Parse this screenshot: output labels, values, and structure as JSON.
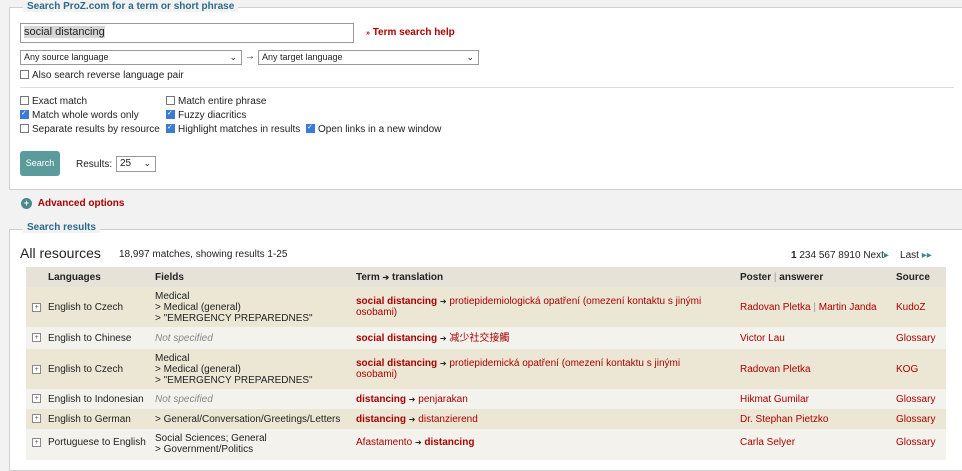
{
  "search_panel": {
    "legend": "Search ProZ.com for a term or short phrase",
    "query_value": "social distancing",
    "help_link": "Term search help",
    "source_lang": "Any source language",
    "target_lang": "Any target language",
    "lang_arrow": "→",
    "reverse_pair": "Also search reverse language pair",
    "options": {
      "exact_match": "Exact match",
      "match_entire_phrase": "Match entire phrase",
      "whole_words": "Match whole words only",
      "fuzzy": "Fuzzy diacritics",
      "separate_results": "Separate results by resource",
      "highlight": "Highlight matches in results",
      "new_window": "Open links in a new window"
    },
    "search_button": "Search",
    "results_label": "Results:",
    "results_value": "25"
  },
  "advanced_options": "Advanced options",
  "results_panel": {
    "legend": "Search results",
    "heading": "All resources",
    "summary": "18,997 matches, showing results 1-25",
    "pagination": {
      "current": "1",
      "pages": [
        "2",
        "3",
        "4",
        "5",
        "6",
        "7",
        "8",
        "9",
        "10"
      ],
      "next": "Next",
      "last": "Last"
    },
    "columns": {
      "languages": "Languages",
      "fields": "Fields",
      "term": "Term",
      "translation": "translation",
      "poster": "Poster",
      "sep": "|",
      "answerer": "answerer",
      "source": "Source"
    },
    "rows": [
      {
        "lang": "English to Czech",
        "field1": "Medical",
        "field2": "> Medical (general)",
        "field3": "> \"EMERGENCY PREPAREDNES\"",
        "term": "social distancing",
        "trans1": "protiepidemiologická opatření (omezení kontaktu s jinými",
        "trans2": "osobami)",
        "poster": "Radovan Pletka",
        "answerer": "Martin Janda",
        "source": "KudoZ"
      },
      {
        "lang": "English to Chinese",
        "field1": "Not specified",
        "term": "social distancing",
        "trans1": "减少社交接觸",
        "poster": "Victor Lau",
        "source": "Glossary"
      },
      {
        "lang": "English to Czech",
        "field1": "Medical",
        "field2": "> Medical (general)",
        "field3": "> \"EMERGENCY PREPAREDNES\"",
        "term": "social distancing",
        "trans1": "protiepidemická opatření (omezení kontaktu s jinými",
        "trans2": "osobami)",
        "poster": "Radovan Pletka",
        "source": "KOG"
      },
      {
        "lang": "English to Indonesian",
        "field1": "Not specified",
        "term": "distancing",
        "trans1": "penjarakan",
        "poster": "Hikmat Gumilar",
        "source": "Glossary"
      },
      {
        "lang": "English to German",
        "field1": "> General/Conversation/Greetings/Letters",
        "term": "distancing",
        "trans1": "distanzierend",
        "poster": "Dr. Stephan Pietzko",
        "source": "Glossary"
      },
      {
        "lang": "Portuguese to English",
        "field1": "Social Sciences; General",
        "field2": "> Government/Politics",
        "term": "Afastamento",
        "trans1": "distancing",
        "poster": "Carla Selyer",
        "source": "Glossary"
      }
    ]
  }
}
